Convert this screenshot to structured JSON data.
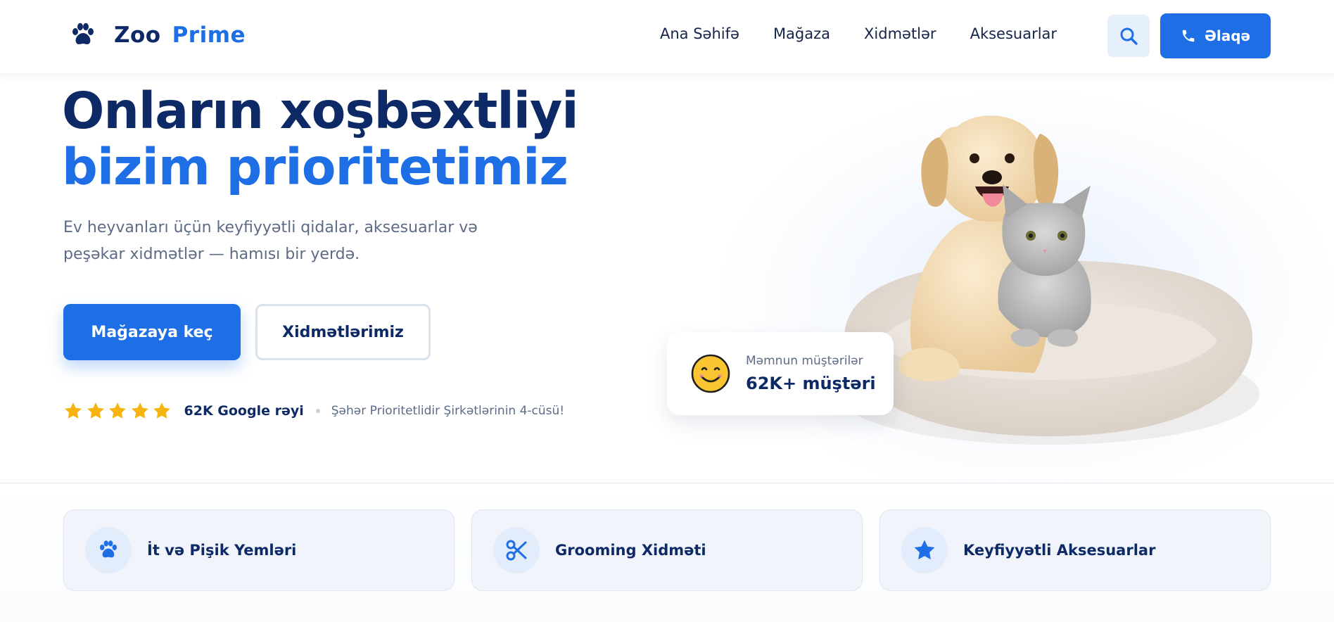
{
  "header": {
    "logo_text": "Zoo",
    "logo_accent": "Prime",
    "nav": [
      "Ana Səhifə",
      "Mağaza",
      "Xidmətlər",
      "Aksesuarlar"
    ],
    "search_icon": "search-icon",
    "contact_label": "Əlaqə",
    "contact_icon": "phone-icon"
  },
  "hero": {
    "title_line1": "Onların xoşbəxtliyi",
    "title_line2": "bizim prioritetimiz",
    "description": "Ev heyvanları üçün keyfiyyətli qidalar, aksesuarlar və peşəkar xidmətlər — hamısı bir yerdə.",
    "primary_button": "Mağazaya keç",
    "secondary_button": "Xidmətlərimiz",
    "rating_stars": 5,
    "rating_text": "62K Google rəyi",
    "rating_sub": "Şəhər Prioritetlidir Şirkətlərinin 4-cüsü!"
  },
  "customers_card": {
    "label": "Məmnun müştərilər",
    "value": "62K+ müştəri",
    "icon": "smiley-icon"
  },
  "features": [
    {
      "label": "İt və Pişik Yemləri",
      "icon": "paw-icon"
    },
    {
      "label": "Grooming Xidməti",
      "icon": "scissors-icon"
    },
    {
      "label": "Keyfiyyətli Aksesuarlar",
      "icon": "star-icon"
    }
  ],
  "colors": {
    "primary": "#1e6fe6",
    "navy": "#0d2a66",
    "muted": "#5d6b86",
    "star": "#f6b40e"
  }
}
